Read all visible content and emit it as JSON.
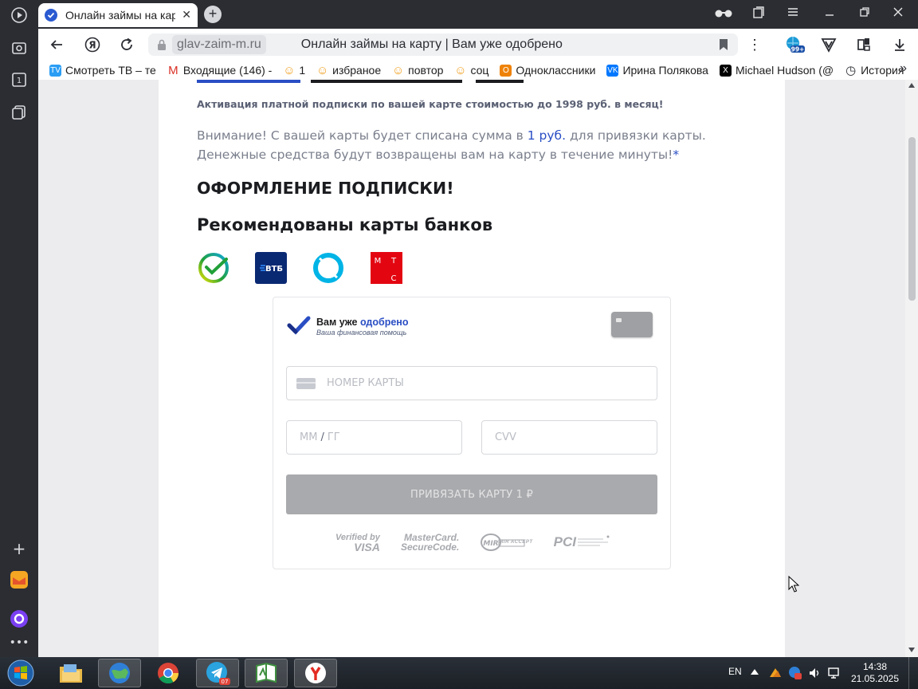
{
  "browser": {
    "tab_title": "Онлайн займы на карт",
    "tab_close": "✕",
    "new_tab": "+",
    "url_domain": "glav-zaim-m.ru",
    "page_title": "Онлайн займы на карту | Вам уже одобрено",
    "bookmarks": [
      {
        "label": "Смотреть ТВ – те",
        "icon": "tv-icon",
        "color": "#2a9df4"
      },
      {
        "label": "Входящие (146) -",
        "icon": "gmail-icon",
        "color": "#d93025"
      },
      {
        "label": "1",
        "icon": "smile-icon",
        "color": "#f0a020"
      },
      {
        "label": "избраное",
        "icon": "smile-icon",
        "color": "#f0a020"
      },
      {
        "label": "повтор",
        "icon": "smile-icon",
        "color": "#f0a020"
      },
      {
        "label": "соц",
        "icon": "smile-icon",
        "color": "#f0a020"
      },
      {
        "label": "Одноклассники",
        "icon": "ok-icon",
        "color": "#ee8208"
      },
      {
        "label": "Ирина Полякова",
        "icon": "vk-icon",
        "color": "#0077ff"
      },
      {
        "label": "Michael Hudson (@",
        "icon": "x-icon",
        "color": "#000000"
      },
      {
        "label": "История",
        "icon": "history-icon",
        "color": "#2b2d33"
      }
    ],
    "bookmarks_more": "»",
    "extension_badge": "99+"
  },
  "page": {
    "subline": "Активация платной подписки по вашей карте стоимостью до 1998 руб. в месяц!",
    "notice_pre": "Внимание! С вашей карты будет списана сумма в ",
    "notice_amount": "1 руб.",
    "notice_post": " для привязки карты. Денежные средства будут возвращены вам на карту в течение минуты!",
    "notice_star": "*",
    "heading": "ОФОРМЛЕНИЕ ПОДПИСКИ!",
    "banks_heading": "Рекомендованы карты банков",
    "banks": [
      "sber",
      "vtb",
      "otkritie",
      "mts"
    ],
    "vtb_label": "ВТБ",
    "mts_letters": [
      "М",
      "Т",
      "С"
    ]
  },
  "form": {
    "brand_plain": "Вам уже ",
    "brand_accent": "одобрено",
    "brand_tagline": "Ваша финансовая помощь",
    "card_number_placeholder": "НОМЕР КАРТЫ",
    "expiry_mm": "ММ",
    "expiry_sep": "/",
    "expiry_yy": "ГГ",
    "cvv_placeholder": "CVV",
    "bind_button": "ПРИВЯЗАТЬ КАРТУ 1 ₽",
    "secure_logos": {
      "verified_top": "Verified by",
      "verified_bottom": "VISA",
      "mc_top": "MasterCard.",
      "mc_bottom": "SecureCode.",
      "mir": "MIR ACCEPT",
      "pci": "PCI"
    }
  },
  "taskbar": {
    "lang": "EN",
    "time": "14:38",
    "date": "21.05.2025",
    "telegram_badge": "07"
  },
  "colors": {
    "accent_blue": "#2a4ec4",
    "sber_green": "#21a038",
    "vtb_navy": "#0a2973",
    "otkritie_cyan": "#00b4e6",
    "mts_red": "#e30611",
    "button_gray": "#a9aaad"
  }
}
